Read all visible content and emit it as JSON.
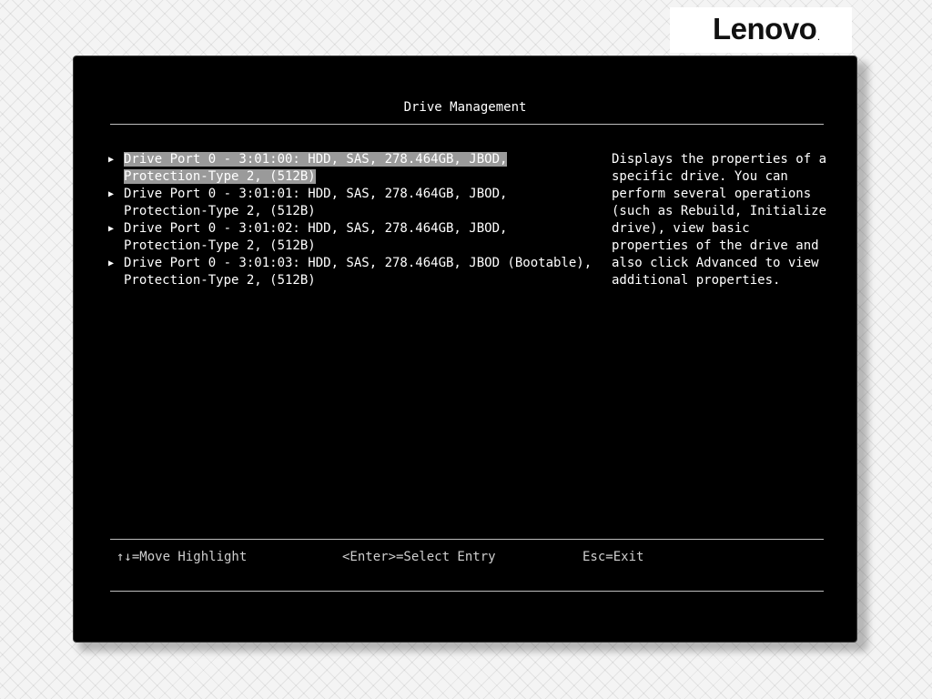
{
  "brand": {
    "logo_text": "Lenovo",
    "logo_mark": "."
  },
  "screen": {
    "title": "Drive Management"
  },
  "drives": [
    {
      "line1": "Drive Port 0 - 3:01:00: HDD, SAS, 278.464GB, JBOD,",
      "line2": "Protection-Type 2, (512B)",
      "selected": true
    },
    {
      "line1": "Drive Port 0 - 3:01:01: HDD, SAS, 278.464GB, JBOD,",
      "line2": "Protection-Type 2, (512B)",
      "selected": false
    },
    {
      "line1": "Drive Port 0 - 3:01:02: HDD, SAS, 278.464GB, JBOD,",
      "line2": "Protection-Type 2, (512B)",
      "selected": false
    },
    {
      "line1": "Drive Port 0 - 3:01:03: HDD, SAS, 278.464GB, JBOD (Bootable),",
      "line2": "Protection-Type 2, (512B)",
      "selected": false
    }
  ],
  "help": {
    "lines": [
      "Displays the properties of a",
      "specific drive. You can",
      "perform several operations",
      "(such as Rebuild, Initialize",
      "drive), view basic",
      "properties of the drive and",
      "also click Advanced to view",
      "additional properties."
    ]
  },
  "footer": {
    "move_highlight": "↑↓=Move Highlight",
    "select_entry": "<Enter>=Select Entry",
    "exit": "Esc=Exit"
  },
  "colors": {
    "window_bg": "#000000",
    "text": "#ffffff",
    "footer_text": "#cfcfcf",
    "highlight": "#9a9a9a",
    "rule": "#bdbdbd"
  }
}
